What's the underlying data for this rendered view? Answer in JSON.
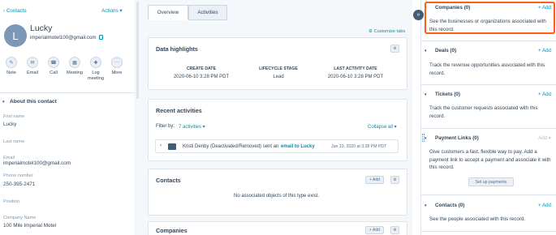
{
  "left": {
    "back_link": "‹ Contacts",
    "actions": "Actions ▾",
    "avatar_initial": "L",
    "name": "Lucky",
    "email": "imperialmotel100@gmail.com",
    "quick_actions": [
      {
        "label": "Note",
        "icon": "note-icon",
        "glyph": "✎"
      },
      {
        "label": "Email",
        "icon": "email-icon",
        "glyph": "✉"
      },
      {
        "label": "Call",
        "icon": "call-icon",
        "glyph": "☎"
      },
      {
        "label": "Meeting",
        "icon": "calendar-icon",
        "glyph": "▦"
      },
      {
        "label": "Log meeting",
        "icon": "log-icon",
        "glyph": "✚"
      },
      {
        "label": "More",
        "icon": "more-icon",
        "glyph": "···"
      }
    ],
    "about_title": "About this contact",
    "fields": [
      {
        "label": "First name",
        "value": "Lucky"
      },
      {
        "label": "Last name",
        "value": ""
      },
      {
        "label": "Email",
        "value": "imperialmotel100@gmail.com"
      },
      {
        "label": "Phone number",
        "value": "250-395-2471"
      },
      {
        "label": "Position",
        "value": ""
      },
      {
        "label": "Company Name",
        "value": "100 Mile Imperial Motel"
      }
    ]
  },
  "middle": {
    "tabs": [
      "Overview",
      "Activities"
    ],
    "customize": "⚙ Customize tabs",
    "highlights": {
      "title": "Data highlights",
      "cols": [
        {
          "label": "CREATE DATE",
          "value": "2020-06-10 3:28 PM PDT"
        },
        {
          "label": "LIFECYCLE STAGE",
          "value": "Lead"
        },
        {
          "label": "LAST ACTIVITY DATE",
          "value": "2020-06-10 3:28 PM PDT"
        }
      ]
    },
    "recent": {
      "title": "Recent activities",
      "filter_label": "Filter by:",
      "filter_value": "7 activities ▾",
      "collapse": "Collapse all ▾",
      "activity_actor": "Kristi Denby (Deactivated/Removed) sent an",
      "activity_link": "email to Lucky",
      "activity_time": "Jun 10, 2020 at 3:28 PM PDT"
    },
    "contacts": {
      "title": "Contacts",
      "add": "+ Add",
      "empty": "No associated objects of this type exist."
    },
    "companies": {
      "title": "Companies",
      "add": "+ Add"
    }
  },
  "right": {
    "sections": [
      {
        "title": "Companies (0)",
        "add": "+ Add",
        "desc": "See the businesses or organizations associated with this record."
      },
      {
        "title": "Deals (0)",
        "add": "+ Add",
        "desc": "Track the revenue opportunities associated with this record."
      },
      {
        "title": "Tickets (0)",
        "add": "+ Add",
        "desc": "Track the customer requests associated with this record."
      },
      {
        "title": "Payment Links (0)",
        "add": "Add ▾",
        "desc": "Give customers a fast, flexible way to pay. Add a payment link to accept a payment and associate it with this record.",
        "button": "Set up payments"
      },
      {
        "title": "Contacts (0)",
        "add": "+ Add",
        "desc": "See the people associated with this record."
      }
    ]
  },
  "colors": {
    "accent": "#0091ae",
    "highlight": "#ff5c1a",
    "text": "#33475b"
  }
}
